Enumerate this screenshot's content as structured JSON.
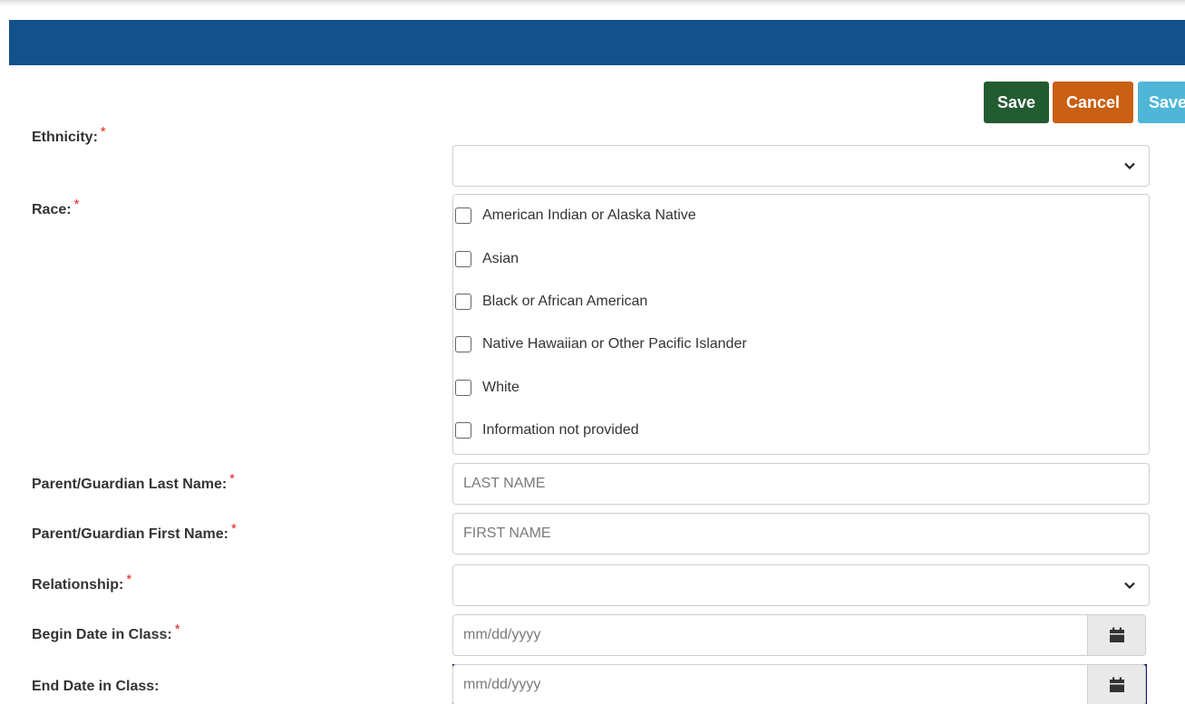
{
  "toolbar": {
    "save_label": "Save",
    "cancel_label": "Cancel",
    "save_secondary_label": "Save"
  },
  "colors": {
    "header": "#12518c",
    "save": "#235b31",
    "cancel": "#c95f12",
    "save_secondary": "#4fb6d7",
    "required": "#e02020"
  },
  "form": {
    "ethnicity": {
      "label": "Ethnicity:",
      "required": "*",
      "value": ""
    },
    "race": {
      "label": "Race:",
      "required": "*",
      "options": [
        "American Indian or Alaska Native",
        "Asian",
        "Black or African American",
        "Native Hawaiian or Other Pacific Islander",
        "White",
        "Information not provided"
      ]
    },
    "guardian_last": {
      "label": "Parent/Guardian Last Name:",
      "required": "*",
      "placeholder": "LAST NAME"
    },
    "guardian_first": {
      "label": "Parent/Guardian First Name:",
      "required": "*",
      "placeholder": "FIRST NAME"
    },
    "relationship": {
      "label": "Relationship:",
      "required": "*",
      "value": ""
    },
    "begin_date": {
      "label": "Begin Date in Class:",
      "required": "*",
      "placeholder": "mm/dd/yyyy"
    },
    "end_date": {
      "label": "End Date in Class:",
      "placeholder": "mm/dd/yyyy"
    }
  },
  "icons": {
    "dropdown": "chevron-down-icon",
    "calendar": "calendar-icon"
  }
}
